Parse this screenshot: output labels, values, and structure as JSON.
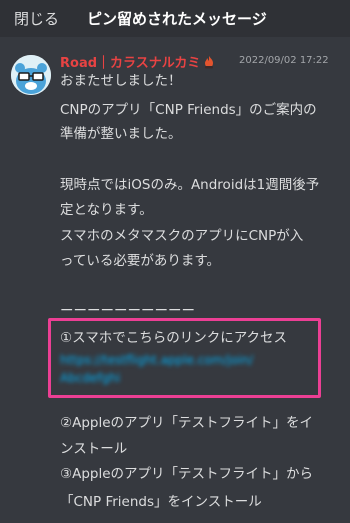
{
  "header": {
    "close_label": "閉じる",
    "title": "ピン留めされたメッセージ"
  },
  "message": {
    "author": "Road｜カラスナルカミ",
    "badge_icon": "flame-role-icon",
    "timestamp": "2022/09/02 17:22",
    "lines": [
      "おまたせしました！",
      "CNPのアプリ「CNP Friends」のご案内の",
      "準備が整いました。",
      "現時点ではiOSのみ。Androidは1週間後予",
      "定となります。",
      "スマホのメタマスクのアプリにCNPが入",
      "っている必要があります。",
      "ーーーーーーーーーー",
      "①スマホでこちらのリンクにアクセス",
      "②Appleのアプリ「テストフライト」をイ",
      "ンストール",
      "③Appleのアプリ「テストフライト」から",
      "「CNP Friends」をインストール"
    ],
    "link_lines": [
      "https://testflight.apple.com/join/",
      "Abcdefghi"
    ]
  },
  "colors": {
    "background": "#36393f",
    "header_bg": "#2f3136",
    "author": "#e84343",
    "link": "#00aff4",
    "highlight": "#ec3f94"
  }
}
